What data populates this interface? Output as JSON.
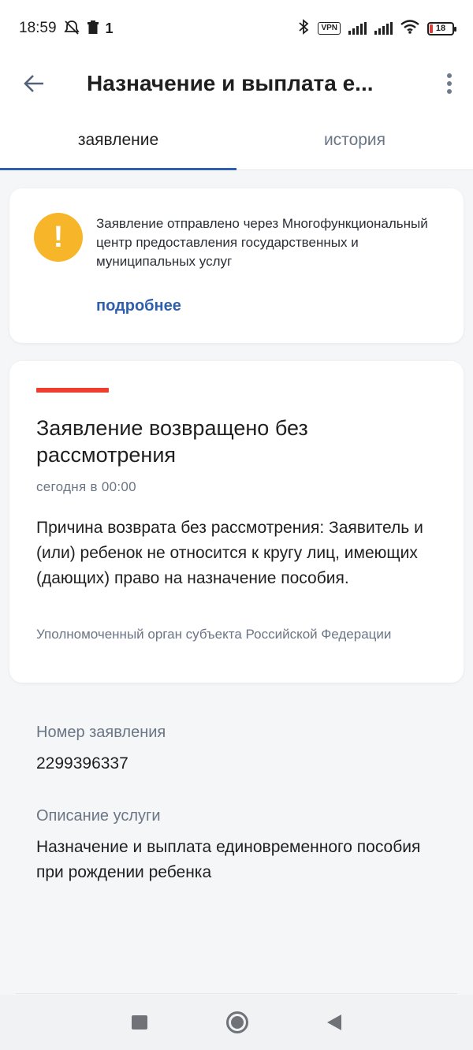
{
  "status_bar": {
    "time": "18:59",
    "left_icons": [
      "mute-icon",
      "trash-icon",
      "sim-icon"
    ],
    "sim_label": "1",
    "right_icons": [
      "bluetooth-icon",
      "vpn-icon",
      "signal-icon",
      "signal-icon",
      "wifi-icon",
      "battery-icon"
    ],
    "vpn_label": "VPN",
    "battery_level": "18",
    "battery_color": "#e53935"
  },
  "app_bar": {
    "back_icon": "arrow-left-icon",
    "title": "Назначение и выплата е...",
    "menu_icon": "more-vert-icon"
  },
  "tabs": [
    {
      "label": "заявление",
      "active": true
    },
    {
      "label": "история",
      "active": false
    }
  ],
  "info_card": {
    "icon": "warning-icon",
    "icon_color": "#f7b52a",
    "text": "Заявление отправлено через Многофункциональный центр предоставления государственных и муниципальных услуг",
    "link": "подробнее",
    "link_color": "#2e5fac"
  },
  "status_card": {
    "accent_color": "#ee3f2e",
    "title": "Заявление возвращено без рассмотрения",
    "time": "сегодня в 00:00",
    "reason": "Причина возврата без рассмотрения: Заявитель и (или) ребенок не относится к кругу лиц, имеющих (дающих) право на назначение пособия.",
    "authority": "Уполномоченный орган субъекта Российской Федерации"
  },
  "details": {
    "number_label": "Номер заявления",
    "number_value": "2299396337",
    "description_label": "Описание услуги",
    "description_value": "Назначение и выплата единовременного пособия при рождении ребенка"
  },
  "nav_bar": {
    "items": [
      "recents-icon",
      "home-icon",
      "back-icon"
    ]
  }
}
